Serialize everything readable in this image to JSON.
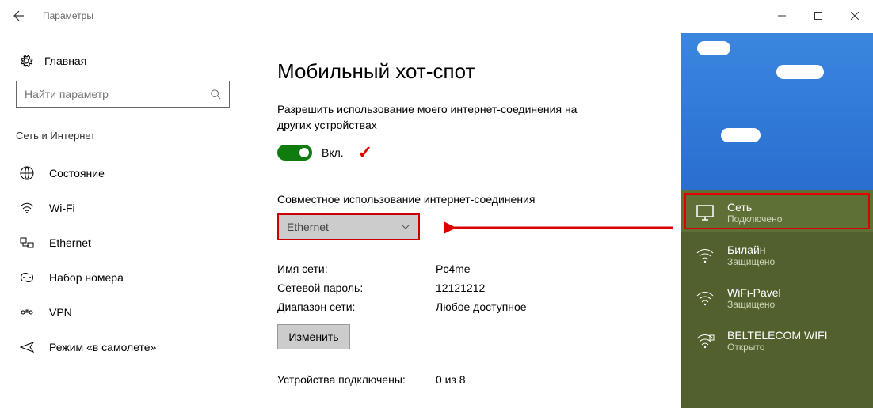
{
  "titlebar": {
    "title": "Параметры"
  },
  "sidebar": {
    "home": "Главная",
    "search_placeholder": "Найти параметр",
    "section": "Сеть и Интернет",
    "items": [
      {
        "label": "Состояние"
      },
      {
        "label": "Wi-Fi"
      },
      {
        "label": "Ethernet"
      },
      {
        "label": "Набор номера"
      },
      {
        "label": "VPN"
      },
      {
        "label": "Режим «в самолете»"
      }
    ]
  },
  "main": {
    "title": "Мобильный хот-спот",
    "share_desc": "Разрешить использование моего интернет-соединения на других устройствах",
    "toggle_state": "Вкл.",
    "conn_heading": "Совместное использование интернет-соединения",
    "dropdown_value": "Ethernet",
    "rows": {
      "name_label": "Имя сети:",
      "name_value": "Pc4me",
      "pass_label": "Сетевой пароль:",
      "pass_value": "12121212",
      "band_label": "Диапазон сети:",
      "band_value": "Любое доступное"
    },
    "edit_btn": "Изменить",
    "devices_label": "Устройства подключены:",
    "devices_value": "0 из 8"
  },
  "flyout": {
    "items": [
      {
        "name": "Сеть",
        "status": "Подключено",
        "type": "ethernet",
        "highlight": true
      },
      {
        "name": "Билайн",
        "status": "Защищено",
        "type": "wifi"
      },
      {
        "name": "WiFi-Pavel",
        "status": "Защищено",
        "type": "wifi"
      },
      {
        "name": "BELTELECOM WIFI",
        "status": "Открыто",
        "type": "wifi-open"
      }
    ]
  },
  "colors": {
    "accent_green": "#107c10",
    "annotation_red": "#d00",
    "flyout_bg": "#51602c"
  }
}
